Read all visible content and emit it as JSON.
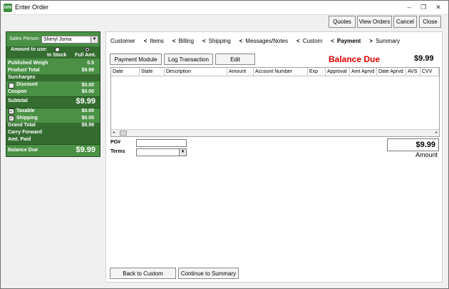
{
  "window": {
    "title": "Enter Order",
    "app_icon_text": "om",
    "minimize_glyph": "–",
    "restore_glyph": "❐",
    "close_glyph": "✕"
  },
  "toolbar": {
    "quotes": "Quotes",
    "view_orders": "View Orders",
    "cancel": "Cancel",
    "close": "Close"
  },
  "left_panel": {
    "sales_person_label": "Sales Person",
    "sales_person_value": "Sheryl Jorna",
    "amount_to_use_label": "Amount to use:",
    "in_stock_label": "In Stock",
    "full_amt_label": "Full Amt.",
    "published_weight_label": "Published Weigh",
    "published_weight_value": "0.5",
    "product_total_label": "Product Total",
    "product_total_value": "$9.99",
    "surcharges_label": "Surcharges",
    "discount_label": "Discount",
    "discount_value": "$0.00",
    "coupon_label": "Coupon",
    "coupon_value": "$0.00",
    "subtotal_label": "Subtotal",
    "subtotal_value": "$9.99",
    "taxable_label": "Taxable",
    "taxable_value": "$0.00",
    "shipping_label": "Shipping",
    "shipping_value": "$0.00",
    "grand_total_label": "Grand Total",
    "grand_total_value": "$9.99",
    "carry_forward_label": "Carry Forward",
    "amt_paid_label": "Amt. Paid",
    "balance_due_label": "Balance Due",
    "balance_due_value": "$9.99",
    "discount_checked": false,
    "taxable_checked": true,
    "shipping_checked": true,
    "check_glyph": "✓",
    "dropdown_glyph": "▼"
  },
  "breadcrumb": {
    "items": [
      "Customer",
      "Items",
      "Billing",
      "Shipping",
      "Messages/Notes",
      "Custom",
      "Payment",
      "Summary"
    ],
    "separator": "<",
    "last_separator": ">"
  },
  "payment": {
    "payment_module_button": "Payment Module",
    "log_transaction_button": "Log Transaction",
    "edit_button": "Edit",
    "balance_due_label": "Balance Due",
    "balance_due_value": "$9.99",
    "columns": [
      "Date",
      "State",
      "Description",
      "Amount",
      "Account Number",
      "Exp",
      "Approval",
      "Amt Aprvd",
      "Date Aprvd",
      "AVS",
      "CVV"
    ],
    "po_label": "PO#",
    "terms_label": "Terms",
    "amount_value": "$9.99",
    "amount_label": "Amount",
    "scroll_left_glyph": "◂",
    "scroll_right_glyph": "▸"
  },
  "footer": {
    "back_button": "Back to Custom",
    "continue_button": "Continue to Summary"
  },
  "colors": {
    "panel_green": "#4a9145",
    "panel_dark_green": "#356d31",
    "balance_red": "#e00000"
  }
}
